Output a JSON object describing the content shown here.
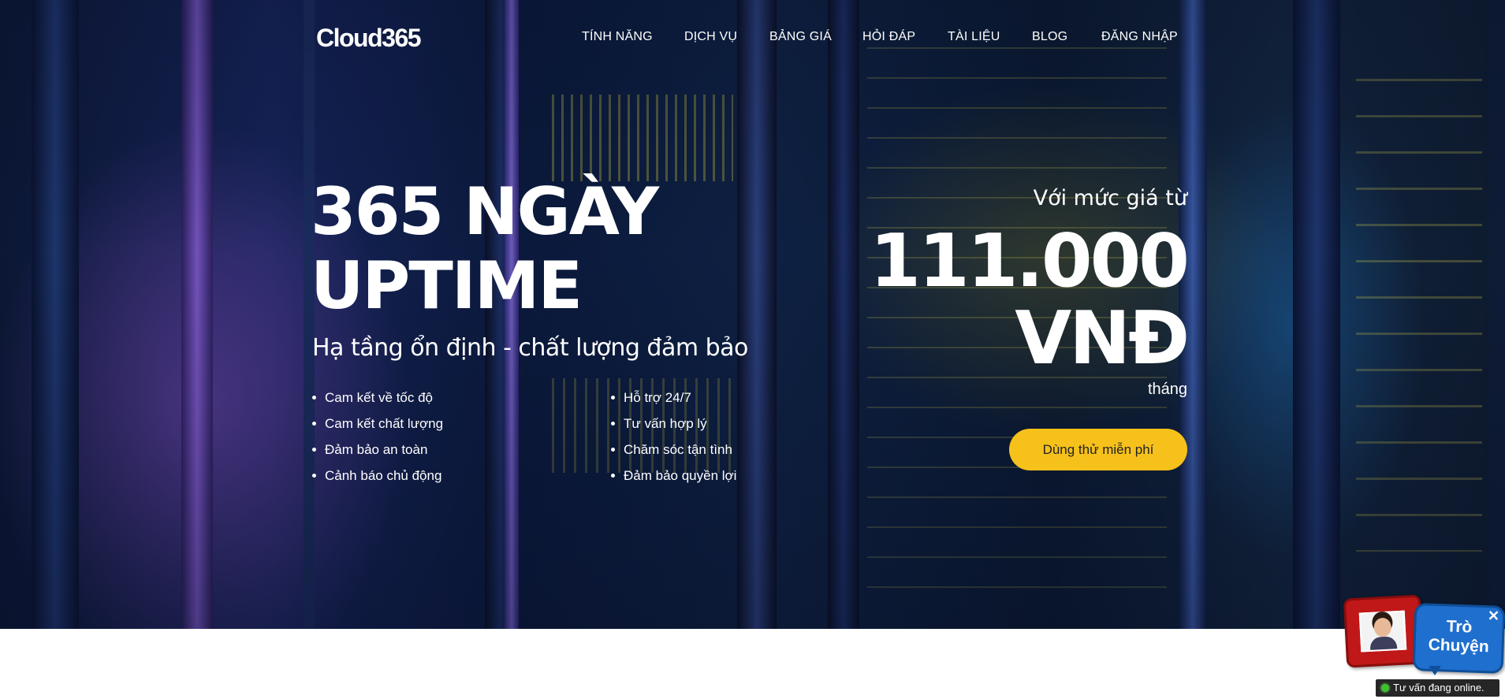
{
  "brand": {
    "logo_text": "Cloud365"
  },
  "nav": {
    "items": [
      {
        "label": "TÍNH NĂNG"
      },
      {
        "label": "DỊCH VỤ"
      },
      {
        "label": "BẢNG GIÁ"
      },
      {
        "label": "HỎI ĐÁP"
      },
      {
        "label": "TÀI LIỆU"
      },
      {
        "label": "BLOG"
      },
      {
        "label": "ĐĂNG NHẬP"
      }
    ]
  },
  "hero": {
    "headline_line1": "365 NGÀY",
    "headline_line2": "UPTIME",
    "subheadline": "Hạ tầng ổn định - chất lượng đảm bảo",
    "features_left": [
      "Cam kết về tốc độ",
      "Cam kết chất lượng",
      "Đảm bảo an toàn",
      "Cảnh báo chủ động"
    ],
    "features_right": [
      "Hỗ trợ 24/7",
      "Tư vấn hợp lý",
      "Chăm sóc tận tình",
      "Đảm bảo quyền lợi"
    ]
  },
  "pricing": {
    "intro": "Với mức giá từ",
    "amount": "111.000",
    "currency": "VNĐ",
    "period": "tháng",
    "cta_label": "Dùng thử miễn phí"
  },
  "chat_widget": {
    "bubble_line1": "Trò",
    "bubble_line2": "Chuyện",
    "close_label": "✕",
    "status_text": "Tư vấn đang online.",
    "status_color": "#3fbf2f"
  },
  "colors": {
    "accent": "#f6c11b",
    "chat_red": "#c01818",
    "chat_blue": "#1f6fcf"
  }
}
